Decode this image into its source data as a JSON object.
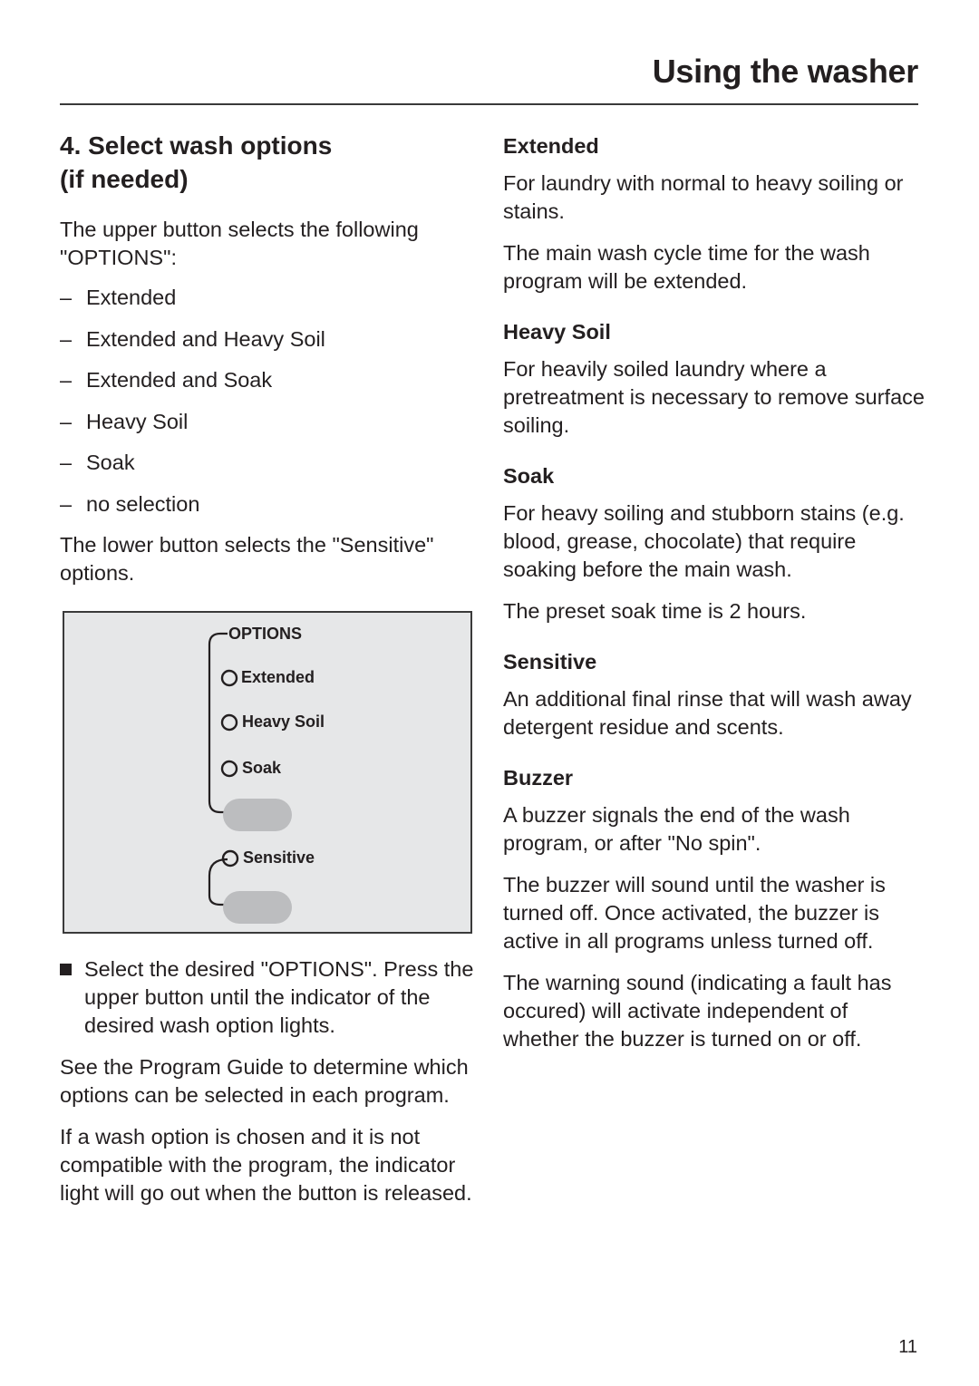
{
  "header": {
    "title": "Using the washer"
  },
  "left": {
    "section_title_line1": "4. Select wash options",
    "section_title_line2": "(if needed)",
    "intro": "The upper button selects the following \"OPTIONS\":",
    "options_list": [
      "Extended",
      "Extended and Heavy Soil",
      "Extended and Soak",
      "Heavy Soil",
      "Soak",
      "no selection"
    ],
    "list_marker": "–",
    "lower_button_text": "The lower button selects the \"Sensitive\" options.",
    "diagram": {
      "group_label": "OPTIONS",
      "indicators": [
        "Extended",
        "Heavy Soil",
        "Soak"
      ],
      "sensitive_label": "Sensitive",
      "colors": {
        "panel": "#e6e7e8",
        "button": "#bcbdbf",
        "line": "#231f20"
      }
    },
    "step": "Select the desired \"OPTIONS\". Press the upper button until the indicator of the desired wash option lights.",
    "guide_note": "See the Program Guide to determine which options can be selected in each program.",
    "incompatible_note": "If a wash option is chosen and it is not compatible with the program, the indicator light will go out when the button is released."
  },
  "right": {
    "extended": {
      "heading": "Extended",
      "p1": "For laundry with normal to heavy soiling or stains.",
      "p2": "The main wash cycle time for the wash program will be extended."
    },
    "heavy_soil": {
      "heading": "Heavy Soil",
      "p1": "For heavily soiled laundry where a pretreatment is necessary to remove surface soiling."
    },
    "soak": {
      "heading": "Soak",
      "p1": "For heavy soiling and stubborn stains (e.g. blood, grease, chocolate) that require soaking before the main wash.",
      "p2": "The preset soak time is 2 hours."
    },
    "sensitive": {
      "heading": "Sensitive",
      "p1": "An additional final rinse that will wash away detergent residue and scents."
    },
    "buzzer": {
      "heading": "Buzzer",
      "p1": "A buzzer signals the end of the wash program, or after \"No spin\".",
      "p2": "The buzzer will sound until the washer is turned off. Once activated, the buzzer is active in all programs unless turned off.",
      "p3": "The warning sound (indicating a fault has occured) will activate independent of whether the buzzer is turned on or off."
    }
  },
  "footer": {
    "page_number": "11"
  }
}
